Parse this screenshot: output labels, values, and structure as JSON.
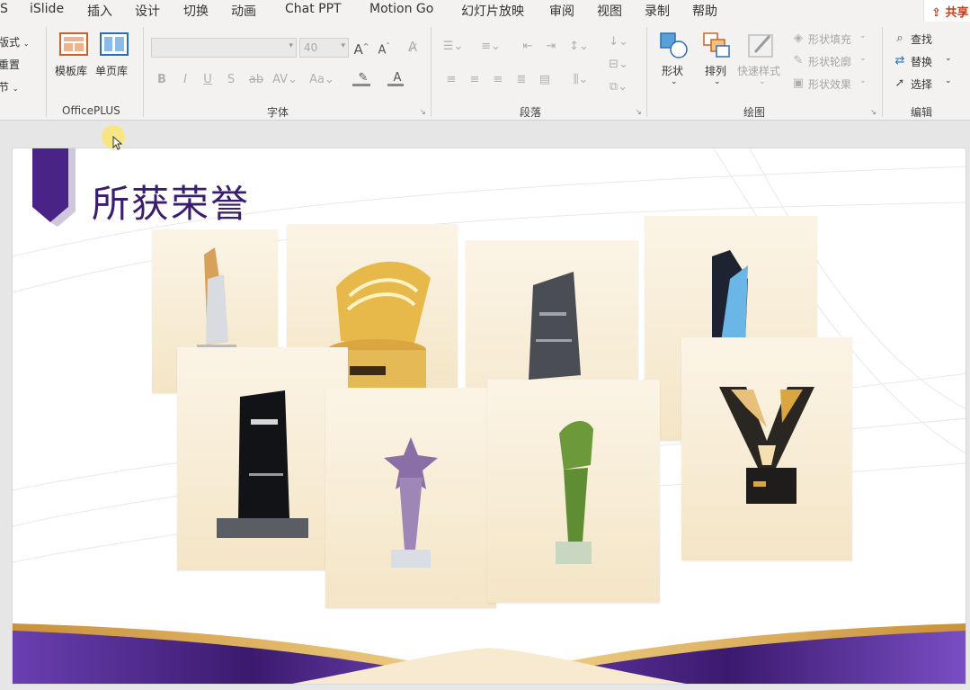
{
  "menu": {
    "items": [
      "S",
      "iSlide",
      "插入",
      "设计",
      "切换",
      "动画",
      "Chat PPT",
      "Motion Go",
      "幻灯片放映",
      "审阅",
      "视图",
      "录制",
      "帮助"
    ],
    "share": "共享"
  },
  "ribbon": {
    "slide_group": {
      "layout": "版式",
      "reset": "重置",
      "section": "节"
    },
    "officeplus": {
      "template_lib": "模板库",
      "single_page_lib": "单页库",
      "label": "OfficePLUS"
    },
    "font": {
      "font_name": "",
      "font_size": "40",
      "label": "字体"
    },
    "paragraph": {
      "label": "段落"
    },
    "drawing": {
      "shape": "形状",
      "arrange": "排列",
      "quick_styles": "快速样式",
      "shape_fill": "形状填充",
      "shape_outline": "形状轮廓",
      "shape_effects": "形状效果",
      "label": "绘图"
    },
    "editing": {
      "find": "查找",
      "replace": "替换",
      "select": "选择",
      "label": "编辑"
    }
  },
  "slide": {
    "title": "所获荣誉",
    "colors": {
      "purple": "#5b2d8e",
      "gold": "#d9a640",
      "cream": "#f4e5c6"
    }
  }
}
